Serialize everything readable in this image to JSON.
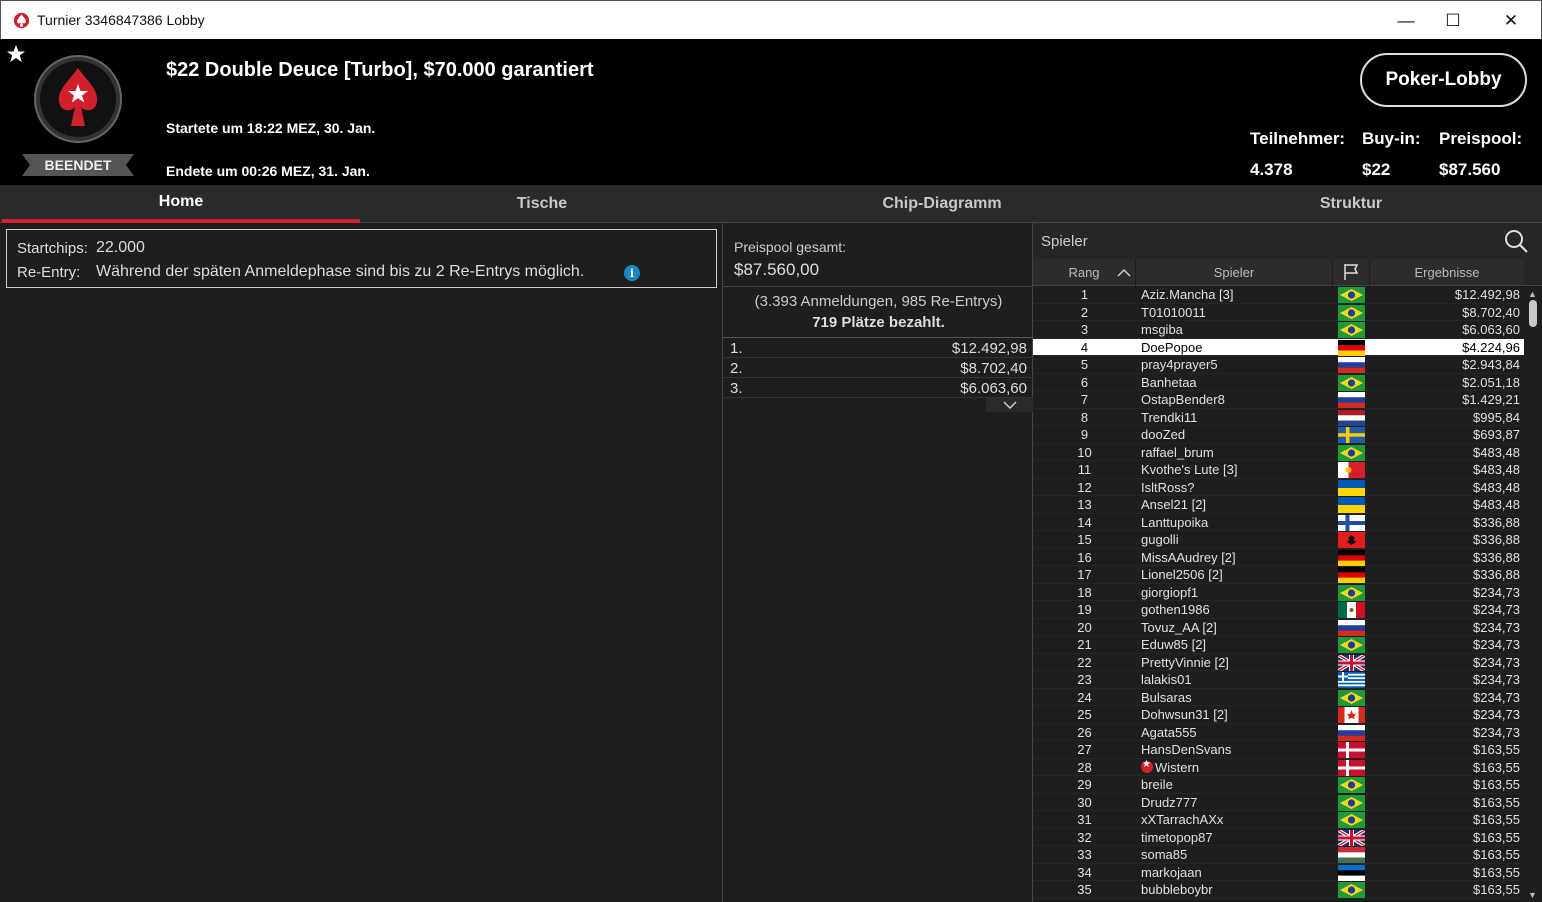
{
  "window": {
    "title": "Turnier 3346847386 Lobby",
    "minimize": "—",
    "maximize": "☐",
    "close": "✕"
  },
  "header": {
    "status": "BEENDET",
    "title": "$22 Double Deuce [Turbo], $70.000 garantiert",
    "started": "Startete um 18:22 MEZ, 30. Jan.",
    "ended": "Endete um 00:26 MEZ, 31. Jan.",
    "lobby_button": "Poker-Lobby",
    "stats": {
      "participants_label": "Teilnehmer:",
      "participants": "4.378",
      "buyin_label": "Buy-in:",
      "buyin": "$22",
      "prizepool_label": "Preispool:",
      "prizepool": "$87.560"
    }
  },
  "tabs": [
    {
      "label": "Home",
      "active": true
    },
    {
      "label": "Tische",
      "active": false
    },
    {
      "label": "Chip-Diagramm",
      "active": false
    },
    {
      "label": "Struktur",
      "active": false
    }
  ],
  "home": {
    "startchips_label": "Startchips:",
    "startchips": "22.000",
    "reentry_label": "Re-Entry:",
    "reentry": "Während der späten Anmeldephase sind bis zu 2 Re-Entrys möglich.",
    "info_icon": "i"
  },
  "prizepool": {
    "label": "Preispool gesamt:",
    "value": "$87.560,00",
    "entries": "(3.393 Anmeldungen, 985 Re-Entrys)",
    "paid": "719 Plätze bezahlt.",
    "places": [
      {
        "place": "1.",
        "amount": "$12.492,98"
      },
      {
        "place": "2.",
        "amount": "$8.702,40"
      },
      {
        "place": "3.",
        "amount": "$6.063,60"
      }
    ]
  },
  "players": {
    "search_placeholder": "Spieler",
    "headers": {
      "rank": "Rang",
      "player": "Spieler",
      "results": "Ergebnisse"
    },
    "selected_rank": "4",
    "colors": {
      "accent": "#d0202c",
      "selected": "#ffffff"
    },
    "rows": [
      {
        "rank": "1",
        "name": "Aziz.Mancha [3]",
        "flag": "br",
        "result": "$12.492,98"
      },
      {
        "rank": "2",
        "name": "T01010011",
        "flag": "br",
        "result": "$8.702,40"
      },
      {
        "rank": "3",
        "name": "msgiba",
        "flag": "br",
        "result": "$6.063,60"
      },
      {
        "rank": "4",
        "name": "DoePopoe",
        "flag": "de",
        "result": "$4.224,96"
      },
      {
        "rank": "5",
        "name": "pray4prayer5",
        "flag": "ru",
        "result": "$2.943,84"
      },
      {
        "rank": "6",
        "name": "Banhetaa",
        "flag": "br",
        "result": "$2.051,18"
      },
      {
        "rank": "7",
        "name": "OstapBender8",
        "flag": "ru",
        "result": "$1.429,21"
      },
      {
        "rank": "8",
        "name": "Trendki11",
        "flag": "nl",
        "result": "$995,84"
      },
      {
        "rank": "9",
        "name": "dooZed",
        "flag": "se",
        "result": "$693,87"
      },
      {
        "rank": "10",
        "name": "raffael_brum",
        "flag": "br",
        "result": "$483,48"
      },
      {
        "rank": "11",
        "name": "Kvothe's Lute [3]",
        "flag": "pt",
        "result": "$483,48"
      },
      {
        "rank": "12",
        "name": "IsltRoss?",
        "flag": "ua",
        "result": "$483,48"
      },
      {
        "rank": "13",
        "name": "Ansel21 [2]",
        "flag": "ua",
        "result": "$483,48"
      },
      {
        "rank": "14",
        "name": "Lanttupoika",
        "flag": "fi",
        "result": "$336,88"
      },
      {
        "rank": "15",
        "name": "gugolli",
        "flag": "al",
        "result": "$336,88"
      },
      {
        "rank": "16",
        "name": "MissAAudrey [2]",
        "flag": "de",
        "result": "$336,88"
      },
      {
        "rank": "17",
        "name": "Lionel2506 [2]",
        "flag": "de",
        "result": "$336,88"
      },
      {
        "rank": "18",
        "name": "giorgiopf1",
        "flag": "br",
        "result": "$234,73"
      },
      {
        "rank": "19",
        "name": "gothen1986",
        "flag": "mx",
        "result": "$234,73"
      },
      {
        "rank": "20",
        "name": "Tovuz_AA [2]",
        "flag": "ru",
        "result": "$234,73"
      },
      {
        "rank": "21",
        "name": "Eduw85 [2]",
        "flag": "br",
        "result": "$234,73"
      },
      {
        "rank": "22",
        "name": "PrettyVinnie [2]",
        "flag": "gb",
        "result": "$234,73"
      },
      {
        "rank": "23",
        "name": "lalakis01",
        "flag": "gr",
        "result": "$234,73"
      },
      {
        "rank": "24",
        "name": "Bulsaras",
        "flag": "br",
        "result": "$234,73"
      },
      {
        "rank": "25",
        "name": "Dohwsun31 [2]",
        "flag": "ca",
        "result": "$234,73"
      },
      {
        "rank": "26",
        "name": "Agata555",
        "flag": "ru",
        "result": "$234,73"
      },
      {
        "rank": "27",
        "name": "HansDenSvans",
        "flag": "dk",
        "result": "$163,55"
      },
      {
        "rank": "28",
        "name": "Wistern",
        "flag": "dk",
        "result": "$163,55",
        "star": true
      },
      {
        "rank": "29",
        "name": "breile",
        "flag": "br",
        "result": "$163,55"
      },
      {
        "rank": "30",
        "name": "Drudz777",
        "flag": "br",
        "result": "$163,55"
      },
      {
        "rank": "31",
        "name": "xXTarrachAXx",
        "flag": "br",
        "result": "$163,55"
      },
      {
        "rank": "32",
        "name": "timetopop87",
        "flag": "gb",
        "result": "$163,55"
      },
      {
        "rank": "33",
        "name": "soma85",
        "flag": "hu",
        "result": "$163,55"
      },
      {
        "rank": "34",
        "name": "markojaan",
        "flag": "ee",
        "result": "$163,55"
      },
      {
        "rank": "35",
        "name": "bubbleboybr",
        "flag": "br",
        "result": "$163,55"
      }
    ]
  }
}
